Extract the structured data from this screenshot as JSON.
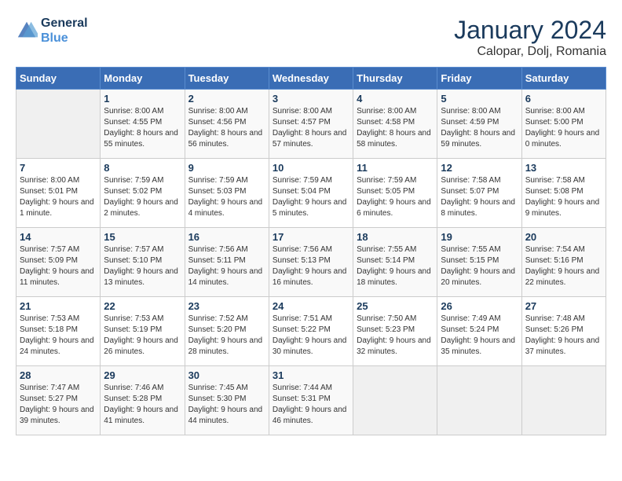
{
  "header": {
    "logo_line1": "General",
    "logo_line2": "Blue",
    "month_title": "January 2024",
    "subtitle": "Calopar, Dolj, Romania"
  },
  "weekdays": [
    "Sunday",
    "Monday",
    "Tuesday",
    "Wednesday",
    "Thursday",
    "Friday",
    "Saturday"
  ],
  "weeks": [
    [
      {
        "day": "",
        "empty": true
      },
      {
        "day": "1",
        "sunrise": "8:00 AM",
        "sunset": "4:55 PM",
        "daylight": "8 hours and 55 minutes."
      },
      {
        "day": "2",
        "sunrise": "8:00 AM",
        "sunset": "4:56 PM",
        "daylight": "8 hours and 56 minutes."
      },
      {
        "day": "3",
        "sunrise": "8:00 AM",
        "sunset": "4:57 PM",
        "daylight": "8 hours and 57 minutes."
      },
      {
        "day": "4",
        "sunrise": "8:00 AM",
        "sunset": "4:58 PM",
        "daylight": "8 hours and 58 minutes."
      },
      {
        "day": "5",
        "sunrise": "8:00 AM",
        "sunset": "4:59 PM",
        "daylight": "8 hours and 59 minutes."
      },
      {
        "day": "6",
        "sunrise": "8:00 AM",
        "sunset": "5:00 PM",
        "daylight": "9 hours and 0 minutes."
      }
    ],
    [
      {
        "day": "7",
        "sunrise": "8:00 AM",
        "sunset": "5:01 PM",
        "daylight": "9 hours and 1 minute."
      },
      {
        "day": "8",
        "sunrise": "7:59 AM",
        "sunset": "5:02 PM",
        "daylight": "9 hours and 2 minutes."
      },
      {
        "day": "9",
        "sunrise": "7:59 AM",
        "sunset": "5:03 PM",
        "daylight": "9 hours and 4 minutes."
      },
      {
        "day": "10",
        "sunrise": "7:59 AM",
        "sunset": "5:04 PM",
        "daylight": "9 hours and 5 minutes."
      },
      {
        "day": "11",
        "sunrise": "7:59 AM",
        "sunset": "5:05 PM",
        "daylight": "9 hours and 6 minutes."
      },
      {
        "day": "12",
        "sunrise": "7:58 AM",
        "sunset": "5:07 PM",
        "daylight": "9 hours and 8 minutes."
      },
      {
        "day": "13",
        "sunrise": "7:58 AM",
        "sunset": "5:08 PM",
        "daylight": "9 hours and 9 minutes."
      }
    ],
    [
      {
        "day": "14",
        "sunrise": "7:57 AM",
        "sunset": "5:09 PM",
        "daylight": "9 hours and 11 minutes."
      },
      {
        "day": "15",
        "sunrise": "7:57 AM",
        "sunset": "5:10 PM",
        "daylight": "9 hours and 13 minutes."
      },
      {
        "day": "16",
        "sunrise": "7:56 AM",
        "sunset": "5:11 PM",
        "daylight": "9 hours and 14 minutes."
      },
      {
        "day": "17",
        "sunrise": "7:56 AM",
        "sunset": "5:13 PM",
        "daylight": "9 hours and 16 minutes."
      },
      {
        "day": "18",
        "sunrise": "7:55 AM",
        "sunset": "5:14 PM",
        "daylight": "9 hours and 18 minutes."
      },
      {
        "day": "19",
        "sunrise": "7:55 AM",
        "sunset": "5:15 PM",
        "daylight": "9 hours and 20 minutes."
      },
      {
        "day": "20",
        "sunrise": "7:54 AM",
        "sunset": "5:16 PM",
        "daylight": "9 hours and 22 minutes."
      }
    ],
    [
      {
        "day": "21",
        "sunrise": "7:53 AM",
        "sunset": "5:18 PM",
        "daylight": "9 hours and 24 minutes."
      },
      {
        "day": "22",
        "sunrise": "7:53 AM",
        "sunset": "5:19 PM",
        "daylight": "9 hours and 26 minutes."
      },
      {
        "day": "23",
        "sunrise": "7:52 AM",
        "sunset": "5:20 PM",
        "daylight": "9 hours and 28 minutes."
      },
      {
        "day": "24",
        "sunrise": "7:51 AM",
        "sunset": "5:22 PM",
        "daylight": "9 hours and 30 minutes."
      },
      {
        "day": "25",
        "sunrise": "7:50 AM",
        "sunset": "5:23 PM",
        "daylight": "9 hours and 32 minutes."
      },
      {
        "day": "26",
        "sunrise": "7:49 AM",
        "sunset": "5:24 PM",
        "daylight": "9 hours and 35 minutes."
      },
      {
        "day": "27",
        "sunrise": "7:48 AM",
        "sunset": "5:26 PM",
        "daylight": "9 hours and 37 minutes."
      }
    ],
    [
      {
        "day": "28",
        "sunrise": "7:47 AM",
        "sunset": "5:27 PM",
        "daylight": "9 hours and 39 minutes."
      },
      {
        "day": "29",
        "sunrise": "7:46 AM",
        "sunset": "5:28 PM",
        "daylight": "9 hours and 41 minutes."
      },
      {
        "day": "30",
        "sunrise": "7:45 AM",
        "sunset": "5:30 PM",
        "daylight": "9 hours and 44 minutes."
      },
      {
        "day": "31",
        "sunrise": "7:44 AM",
        "sunset": "5:31 PM",
        "daylight": "9 hours and 46 minutes."
      },
      {
        "day": "",
        "empty": true
      },
      {
        "day": "",
        "empty": true
      },
      {
        "day": "",
        "empty": true
      }
    ]
  ],
  "labels": {
    "sunrise_label": "Sunrise:",
    "sunset_label": "Sunset:",
    "daylight_label": "Daylight:"
  }
}
